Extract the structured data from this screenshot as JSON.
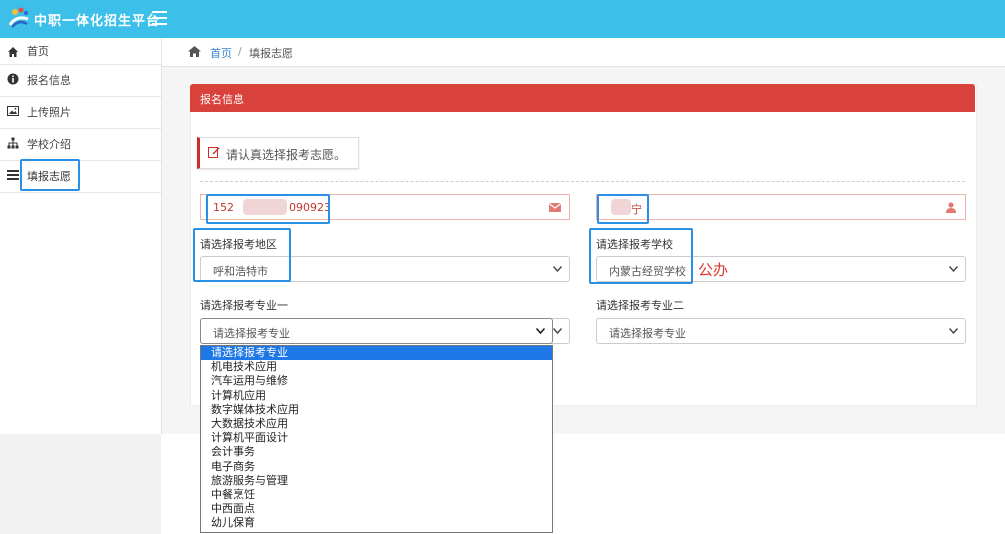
{
  "header": {
    "brand": "中职一体化招生平台"
  },
  "sidebar": {
    "items": [
      {
        "label": "首页",
        "icon": "home-icon"
      },
      {
        "label": "报名信息",
        "icon": "info-icon"
      },
      {
        "label": "上传照片",
        "icon": "image-icon"
      },
      {
        "label": "学校介绍",
        "icon": "sitemap-icon"
      },
      {
        "label": "填报志愿",
        "icon": "list-icon"
      }
    ]
  },
  "breadcrumb": {
    "home": "首页",
    "separator": "/",
    "current": "填报志愿"
  },
  "panel": {
    "title": "报名信息",
    "note": "请认真选择报考志愿。"
  },
  "form": {
    "phone_prefix": "152",
    "phone_suffix": "090923",
    "name_value": "宁",
    "region_label": "请选择报考地区",
    "region_value": "呼和浩特市",
    "school_label": "请选择报考学校",
    "school_value": "内蒙古经贸学校",
    "school_tag": "公办",
    "major1_label": "请选择报考专业一",
    "major1_value": "请选择报考专业",
    "major2_label": "请选择报考专业二",
    "major2_value": "请选择报考专业"
  },
  "dropdown": {
    "options": [
      "请选择报考专业",
      "机电技术应用",
      "汽车运用与维修",
      "计算机应用",
      "数字媒体技术应用",
      "大数据技术应用",
      "计算机平面设计",
      "会计事务",
      "电子商务",
      "旅游服务与管理",
      "中餐烹饪",
      "中西面点",
      "幼儿保育"
    ]
  },
  "colors": {
    "topbar": "#3cc0ea",
    "panel_header": "#d9423a",
    "highlight": "#2a8fe6",
    "selected_option": "#1e77e6",
    "tag": "#e0392c"
  }
}
